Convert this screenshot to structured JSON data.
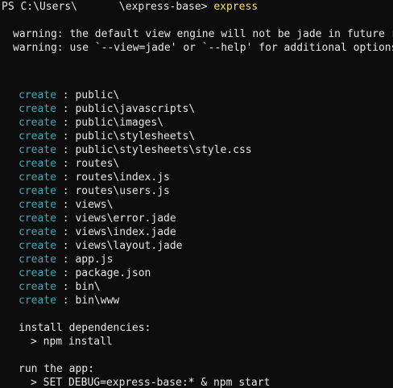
{
  "prompt": {
    "prefix": "PS C:\\Users\\",
    "suffix": "\\express-base>",
    "command": "express"
  },
  "warnings": [
    "warning: the default view engine will not be jade in future releases",
    "warning: use `--view=jade' or `--help' for additional options"
  ],
  "create_label": "create",
  "separator": " : ",
  "created": [
    "public\\",
    "public\\javascripts\\",
    "public\\images\\",
    "public\\stylesheets\\",
    "public\\stylesheets\\style.css",
    "routes\\",
    "routes\\index.js",
    "routes\\users.js",
    "views\\",
    "views\\error.jade",
    "views\\index.jade",
    "views\\layout.jade",
    "app.js",
    "package.json",
    "bin\\",
    "bin\\www"
  ],
  "install": {
    "heading": "install dependencies:",
    "command": "> npm install"
  },
  "run": {
    "heading": "run the app:",
    "command": "> SET DEBUG=express-base:* & npm start"
  },
  "colors": {
    "background": "#0c0c0c",
    "text": "#e6e6e6",
    "command": "#f2e144",
    "create": "#3aa9b8"
  }
}
